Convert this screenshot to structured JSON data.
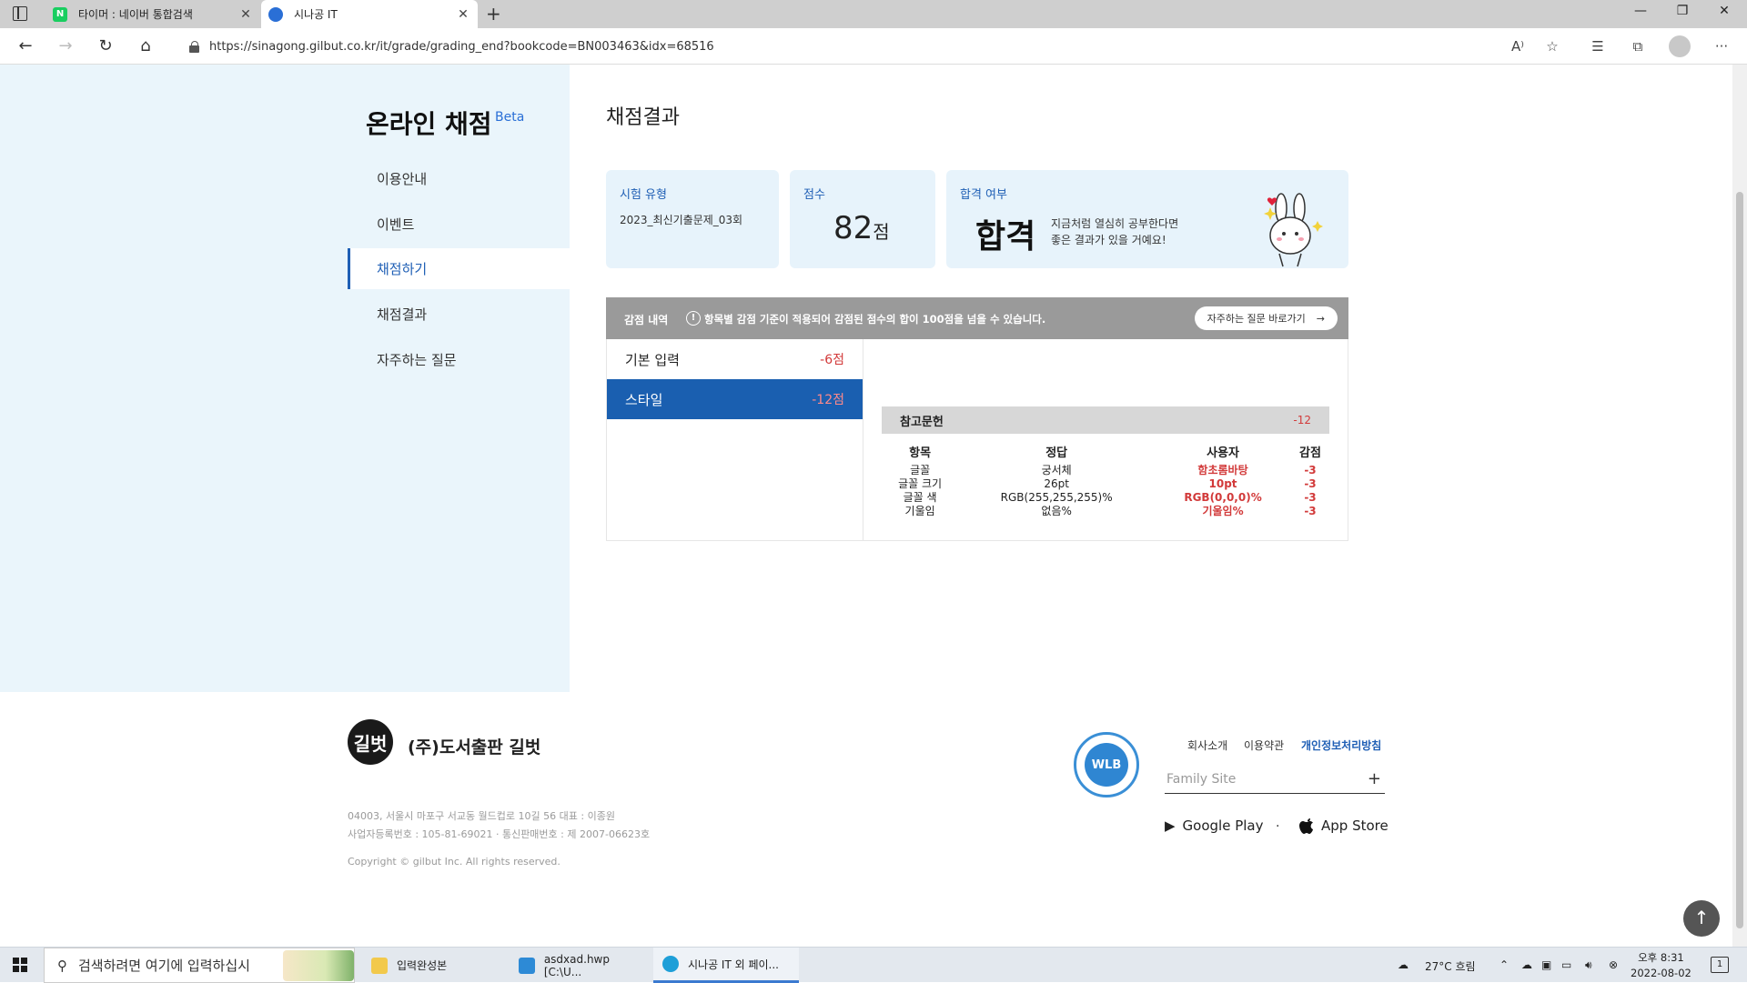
{
  "browser": {
    "tabs": [
      {
        "label": "타이머 : 네이버 통합검색",
        "favicon": "naver-icon"
      },
      {
        "label": "시나공 IT",
        "favicon": "sinagong-icon"
      }
    ],
    "url": "https://sinagong.gilbut.co.kr/it/grade/grading_end?bookcode=BN003463&idx=68516"
  },
  "sidebar": {
    "title": "온라인 채점",
    "badge": "Beta",
    "items": [
      {
        "label": "이용안내"
      },
      {
        "label": "이벤트"
      },
      {
        "label": "채점하기"
      },
      {
        "label": "채점결과"
      },
      {
        "label": "자주하는 질문"
      }
    ],
    "active_index": 2
  },
  "main": {
    "title": "채점결과",
    "exam_type": {
      "label": "시험 유형",
      "value": "2023_최신기출문제_03회"
    },
    "score": {
      "label": "점수",
      "value": "82",
      "unit": "점"
    },
    "result": {
      "label": "합격 여부",
      "value": "합격",
      "message_line1": "지금처럼 열심히 공부한다면",
      "message_line2": "좋은 결과가 있을 거예요!"
    },
    "deduction": {
      "title": "감점 내역",
      "note": "항목별 감점 기준이 적용되어 감점된 점수의 합이 100점을 넘을 수 있습니다.",
      "faq_button": "자주하는 질문 바로가기",
      "categories": [
        {
          "label": "기본 입력",
          "points": "-6점"
        },
        {
          "label": "스타일",
          "points": "-12점"
        }
      ],
      "active_category": 1,
      "section": {
        "title": "참고문헌",
        "points": "-12"
      },
      "table": {
        "headers": [
          "항목",
          "정답",
          "사용자",
          "감점"
        ],
        "rows": [
          [
            "글꼴",
            "궁서체",
            "함초롬바탕",
            "-3"
          ],
          [
            "글꼴 크기",
            "26pt",
            "10pt",
            "-3"
          ],
          [
            "글꼴 색",
            "RGB(255,255,255)%",
            "RGB(0,0,0)%",
            "-3"
          ],
          [
            "기울임",
            "없음%",
            "기울임%",
            "-3"
          ]
        ]
      }
    }
  },
  "footer": {
    "logo_text": "길벗",
    "company": "(주)도서출판 길벗",
    "address": "04003, 서울시 마포구 서교동 월드컵로 10길 56 대표 : 이종원",
    "registration": "사업자등록번호 : 105-81-69021  ·  통신판매번호 : 제 2007-06623호",
    "copyright": "Copyright © gilbut Inc. All rights reserved.",
    "links": [
      "회사소개",
      "이용약관",
      "개인정보처리방침"
    ],
    "wlb": "WLB",
    "family_site": "Family Site",
    "google_play": "Google Play",
    "app_store": "App Store"
  },
  "taskbar": {
    "search_placeholder": "검색하려면 여기에 입력하십시",
    "apps": [
      {
        "label": "입력완성본"
      },
      {
        "label": "asdxad.hwp [C:\\U..."
      },
      {
        "label": "시나공 IT 외 페이..."
      }
    ],
    "weather": "27°C  흐림",
    "time": "오후 8:31",
    "date": "2022-08-02",
    "notification_count": "1"
  }
}
